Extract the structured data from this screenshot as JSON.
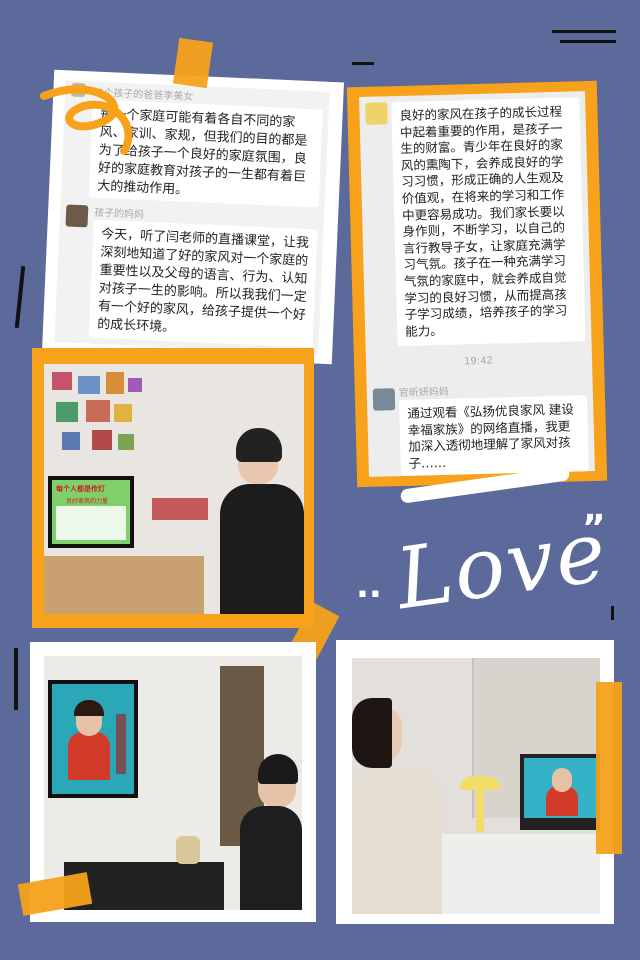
{
  "chat_left": {
    "user1": "这个孩子的爸爸李美女",
    "msg1": "每一个家庭可能有着各自不同的家风、家训、家规，但我们的目的都是为了给孩子一个良好的家庭氛围，良好的家庭教育对孩子的一生都有着巨大的推动作用。",
    "user2": "孩子的妈妈",
    "msg2": "今天，听了闫老师的直播课堂，让我深刻地知道了好的家风对一个家庭的重要性以及父母的语言、行为、认知对孩子一生的影响。所以我我们一定有一个好的家风，给孩子提供一个好的成长环境。"
  },
  "chat_right": {
    "msg1": "良好的家风在孩子的成长过程中起着重要的作用，是孩子一生的财富。青少年在良好的家风的熏陶下，会养成良好的学习习惯，形成正确的人生观及价值观，在将来的学习和工作中更容易成功。我们家长要以身作则，不断学习，以自己的言行教导子女，让家庭充满学习气氛。孩子在一种充满学习气氛的家庭中，就会养成自觉学习的良好习惯，从而提高孩子学习成绩，培养孩子的学习能力。",
    "time": "19:42",
    "user2": "官昕妍妈妈",
    "msg2": "通过观看《弘扬优良家风 建设幸福家族》的网络直播，我更加深入透彻地理解了家风对孩子……"
  },
  "photo1": {
    "screen_title": "每个人都是传灯",
    "screen_sub": "良好家风的力量"
  },
  "decor": {
    "love": "Love",
    "love_prefix": "..",
    "love_quote": "”"
  },
  "colors": {
    "background": "#5b6a9a",
    "orange": "#f7a21a",
    "white": "#ffffff"
  }
}
